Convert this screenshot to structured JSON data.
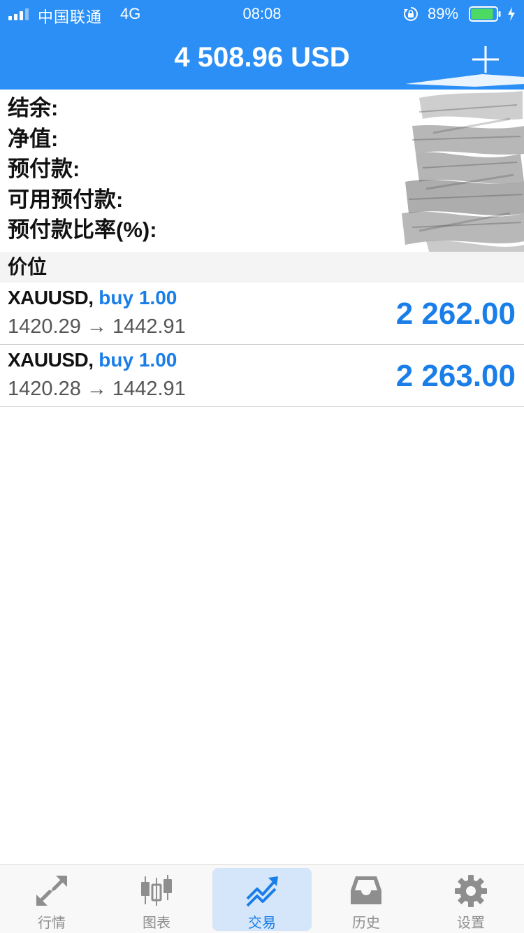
{
  "status_bar": {
    "carrier": "中国联通",
    "network": "4G",
    "time": "08:08",
    "battery_percent": "89%",
    "battery_level": 0.89,
    "signal_bars_active": 3,
    "signal_bars_total": 4
  },
  "header": {
    "balance": "4 508.96 USD",
    "add_icon": "plus-icon"
  },
  "summary": {
    "balance_label": "结余:",
    "equity_label": "净值:",
    "margin_label": "预付款:",
    "free_margin_label": "可用预付款:",
    "margin_level_label": "预付款比率(%):"
  },
  "section": {
    "title": "价位"
  },
  "positions": [
    {
      "symbol": "XAUUSD,",
      "type": "buy 1.00",
      "prices": "1420.29 → 1442.91",
      "profit": "2 262.00"
    },
    {
      "symbol": "XAUUSD,",
      "type": "buy 1.00",
      "prices": "1420.28 → 1442.91",
      "profit": "2 263.00"
    }
  ],
  "tabs": [
    {
      "label": "行情",
      "icon": "quotes-arrows-icon",
      "active": false
    },
    {
      "label": "图表",
      "icon": "candlestick-chart-icon",
      "active": false
    },
    {
      "label": "交易",
      "icon": "trade-trend-icon",
      "active": true
    },
    {
      "label": "历史",
      "icon": "history-inbox-icon",
      "active": false
    },
    {
      "label": "设置",
      "icon": "settings-gear-icon",
      "active": false
    }
  ],
  "colors": {
    "primary": "#2b8ff5",
    "accent_text": "#1a7ee8",
    "active_tab_bg": "#d5e6fa",
    "inactive_icon": "#8e8e8e"
  }
}
